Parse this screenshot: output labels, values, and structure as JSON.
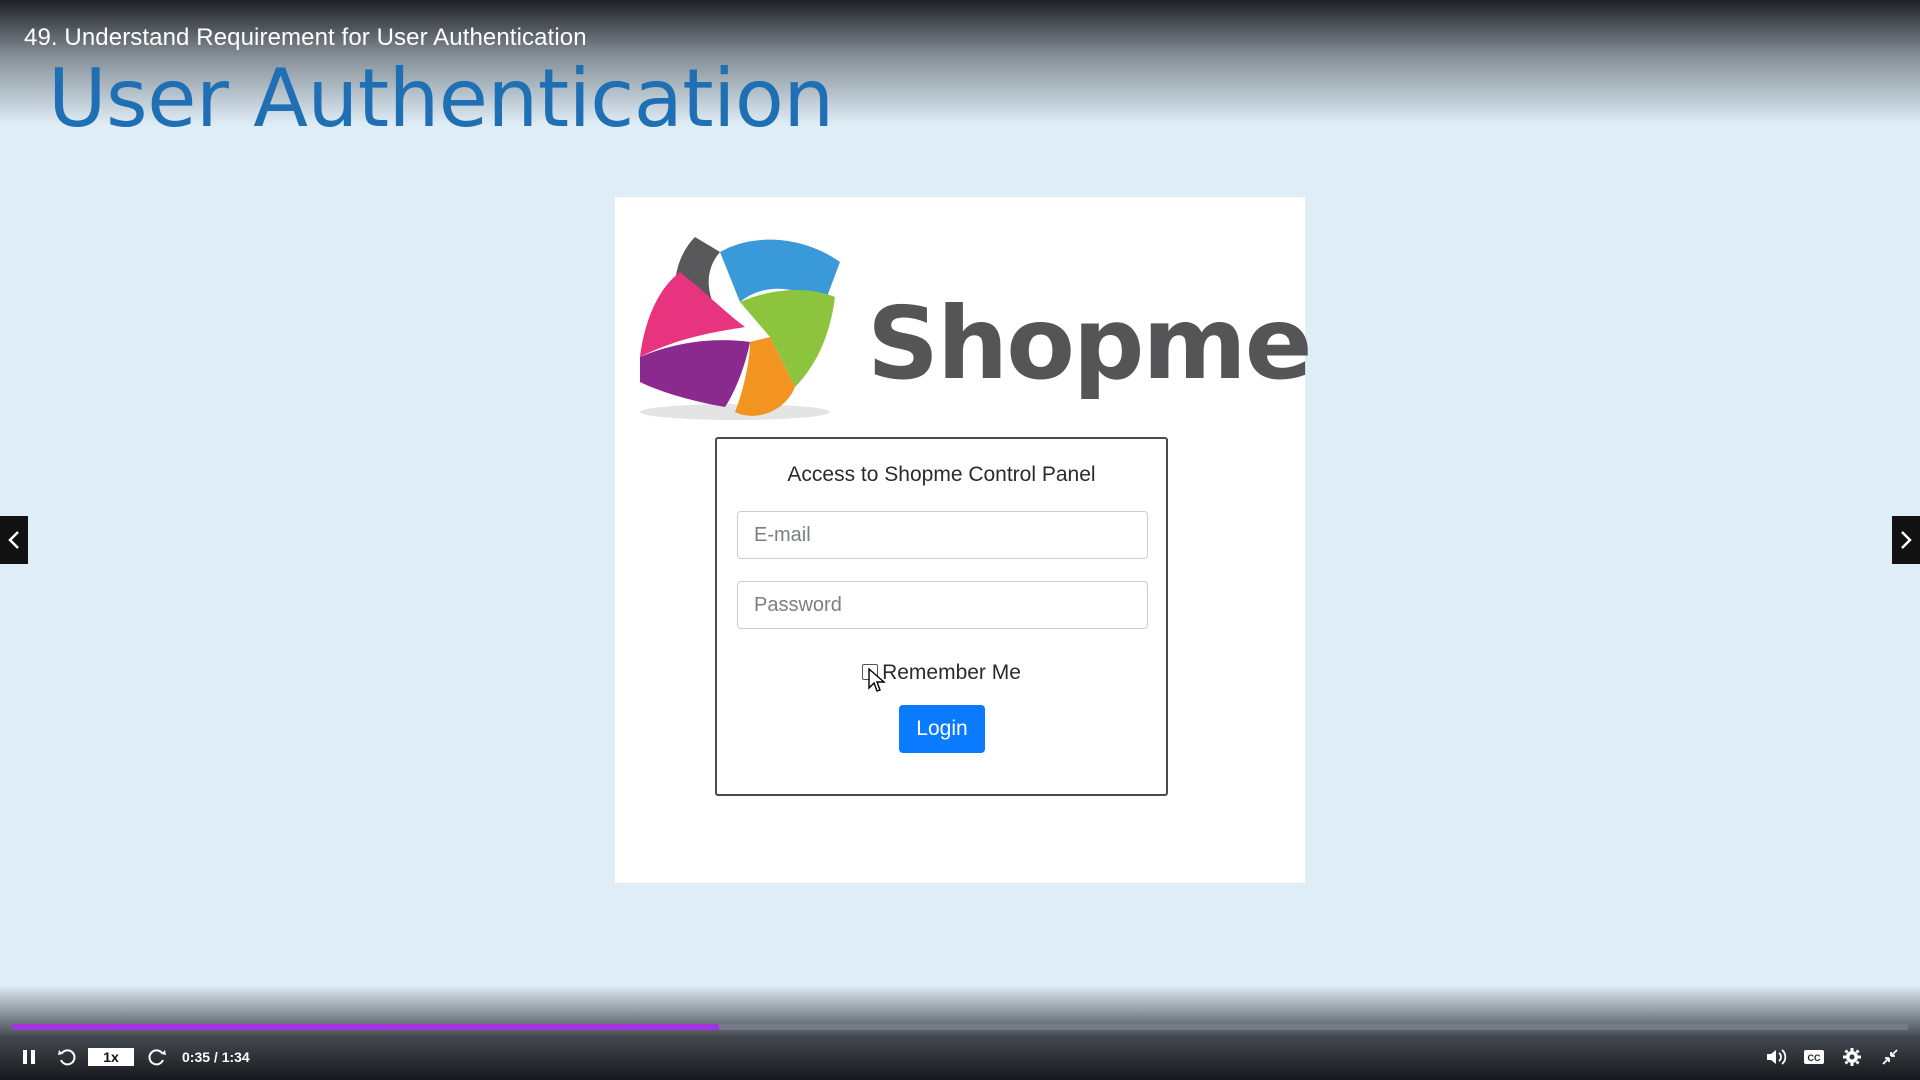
{
  "player": {
    "video_title": "49. Understand Requirement for User Authentication",
    "speed": "1x",
    "time": "0:35 / 1:34",
    "progress_fraction": 0.373,
    "accent_color": "#a035e0",
    "icons": [
      "pause-icon",
      "replay-icon",
      "forward-icon",
      "volume-icon",
      "captions-icon",
      "settings-icon",
      "exit-fullscreen-icon",
      "chevron-left-icon",
      "chevron-right-icon"
    ]
  },
  "slide": {
    "heading": "User Authentication",
    "heading_color": "#1e6fb3"
  },
  "app": {
    "logo_text": "Shopme",
    "card_title": "Access to Shopme Control Panel",
    "email_placeholder": "E-mail",
    "email_value": "",
    "password_placeholder": "Password",
    "password_value": "",
    "remember_label": "Remember Me",
    "remember_checked": false,
    "login_label": "Login",
    "button_color": "#0a7bff"
  }
}
